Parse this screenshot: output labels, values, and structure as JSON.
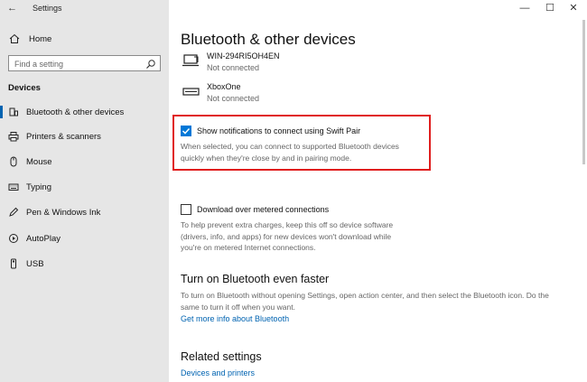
{
  "window": {
    "title": "Settings",
    "back_glyph": "←",
    "minimize_glyph": "—",
    "maximize_glyph": "☐",
    "close_glyph": "✕"
  },
  "sidebar": {
    "home_label": "Home",
    "search_placeholder": "Find a setting",
    "section_label": "Devices",
    "items": [
      {
        "label": "Bluetooth & other devices",
        "icon": "bluetooth-icon",
        "active": true
      },
      {
        "label": "Printers & scanners",
        "icon": "printer-icon",
        "active": false
      },
      {
        "label": "Mouse",
        "icon": "mouse-icon",
        "active": false
      },
      {
        "label": "Typing",
        "icon": "keyboard-icon",
        "active": false
      },
      {
        "label": "Pen & Windows Ink",
        "icon": "pen-icon",
        "active": false
      },
      {
        "label": "AutoPlay",
        "icon": "autoplay-icon",
        "active": false
      },
      {
        "label": "USB",
        "icon": "usb-icon",
        "active": false
      }
    ]
  },
  "main": {
    "title": "Bluetooth & other devices",
    "devices": [
      {
        "name": "WIN-294RI5OH4EN",
        "status": "Not connected",
        "icon": "computer-icon"
      },
      {
        "name": "XboxOne",
        "status": "Not connected",
        "icon": "xbox-icon"
      }
    ],
    "swift_pair": {
      "label": "Show notifications to connect using Swift Pair",
      "checked": true,
      "description_line1": "When selected, you can connect to supported Bluetooth devices",
      "description_line2": "quickly when they're close by and in pairing mode."
    },
    "metered": {
      "label": "Download over metered connections",
      "checked": false,
      "description_line1": "To help prevent extra charges, keep this off so device software",
      "description_line2": "(drivers, info, and apps) for new devices won't download while",
      "description_line3": "you're on metered Internet connections."
    },
    "faster": {
      "title": "Turn on Bluetooth even faster",
      "description_line1": "To turn on Bluetooth without opening Settings, open action center, and then select the Bluetooth icon. Do the",
      "description_line2": "same to turn it off when you want.",
      "link": "Get more info about Bluetooth"
    },
    "related": {
      "title": "Related settings",
      "link": "Devices and printers"
    }
  },
  "colors": {
    "accent": "#0078d7",
    "link": "#0063b1",
    "highlight_border": "#e01e1e",
    "sidebar_bg": "#e6e6e6"
  }
}
